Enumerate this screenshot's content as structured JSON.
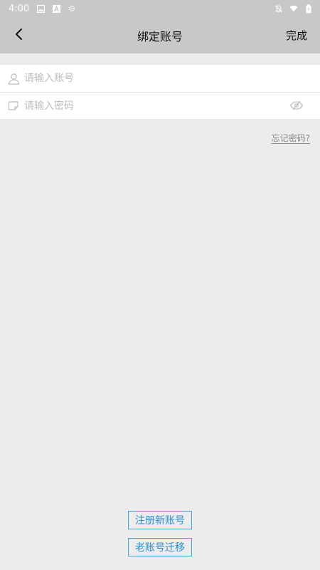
{
  "status_bar": {
    "time": "4:00",
    "icons": [
      "image-icon",
      "a-icon",
      "gear-icon",
      "notification-off-icon",
      "wifi-icon",
      "battery-icon"
    ]
  },
  "app_bar": {
    "title": "绑定账号",
    "done_label": "完成",
    "back_icon": "chevron-left-icon"
  },
  "form": {
    "account_placeholder": "请输入账号",
    "account_value": "",
    "password_placeholder": "请输入密码",
    "password_value": ""
  },
  "forgot_password": "忘记密码?",
  "buttons": {
    "register": "注册新账号",
    "migrate": "老账号迁移"
  },
  "colors": {
    "header_bg": "#c8c8c8",
    "page_bg": "#ececec",
    "accent": "#2a8ccc"
  }
}
